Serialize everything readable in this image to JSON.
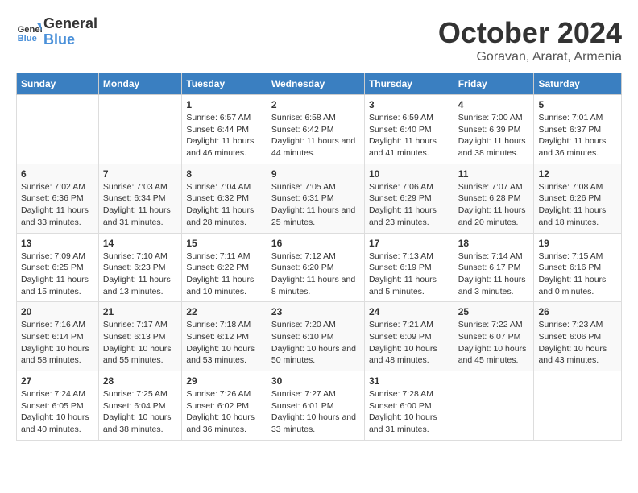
{
  "header": {
    "logo_line1": "General",
    "logo_line2": "Blue",
    "title": "October 2024",
    "subtitle": "Goravan, Ararat, Armenia"
  },
  "columns": [
    "Sunday",
    "Monday",
    "Tuesday",
    "Wednesday",
    "Thursday",
    "Friday",
    "Saturday"
  ],
  "weeks": [
    [
      {
        "day": "",
        "info": ""
      },
      {
        "day": "",
        "info": ""
      },
      {
        "day": "1",
        "info": "Sunrise: 6:57 AM\nSunset: 6:44 PM\nDaylight: 11 hours and 46 minutes."
      },
      {
        "day": "2",
        "info": "Sunrise: 6:58 AM\nSunset: 6:42 PM\nDaylight: 11 hours and 44 minutes."
      },
      {
        "day": "3",
        "info": "Sunrise: 6:59 AM\nSunset: 6:40 PM\nDaylight: 11 hours and 41 minutes."
      },
      {
        "day": "4",
        "info": "Sunrise: 7:00 AM\nSunset: 6:39 PM\nDaylight: 11 hours and 38 minutes."
      },
      {
        "day": "5",
        "info": "Sunrise: 7:01 AM\nSunset: 6:37 PM\nDaylight: 11 hours and 36 minutes."
      }
    ],
    [
      {
        "day": "6",
        "info": "Sunrise: 7:02 AM\nSunset: 6:36 PM\nDaylight: 11 hours and 33 minutes."
      },
      {
        "day": "7",
        "info": "Sunrise: 7:03 AM\nSunset: 6:34 PM\nDaylight: 11 hours and 31 minutes."
      },
      {
        "day": "8",
        "info": "Sunrise: 7:04 AM\nSunset: 6:32 PM\nDaylight: 11 hours and 28 minutes."
      },
      {
        "day": "9",
        "info": "Sunrise: 7:05 AM\nSunset: 6:31 PM\nDaylight: 11 hours and 25 minutes."
      },
      {
        "day": "10",
        "info": "Sunrise: 7:06 AM\nSunset: 6:29 PM\nDaylight: 11 hours and 23 minutes."
      },
      {
        "day": "11",
        "info": "Sunrise: 7:07 AM\nSunset: 6:28 PM\nDaylight: 11 hours and 20 minutes."
      },
      {
        "day": "12",
        "info": "Sunrise: 7:08 AM\nSunset: 6:26 PM\nDaylight: 11 hours and 18 minutes."
      }
    ],
    [
      {
        "day": "13",
        "info": "Sunrise: 7:09 AM\nSunset: 6:25 PM\nDaylight: 11 hours and 15 minutes."
      },
      {
        "day": "14",
        "info": "Sunrise: 7:10 AM\nSunset: 6:23 PM\nDaylight: 11 hours and 13 minutes."
      },
      {
        "day": "15",
        "info": "Sunrise: 7:11 AM\nSunset: 6:22 PM\nDaylight: 11 hours and 10 minutes."
      },
      {
        "day": "16",
        "info": "Sunrise: 7:12 AM\nSunset: 6:20 PM\nDaylight: 11 hours and 8 minutes."
      },
      {
        "day": "17",
        "info": "Sunrise: 7:13 AM\nSunset: 6:19 PM\nDaylight: 11 hours and 5 minutes."
      },
      {
        "day": "18",
        "info": "Sunrise: 7:14 AM\nSunset: 6:17 PM\nDaylight: 11 hours and 3 minutes."
      },
      {
        "day": "19",
        "info": "Sunrise: 7:15 AM\nSunset: 6:16 PM\nDaylight: 11 hours and 0 minutes."
      }
    ],
    [
      {
        "day": "20",
        "info": "Sunrise: 7:16 AM\nSunset: 6:14 PM\nDaylight: 10 hours and 58 minutes."
      },
      {
        "day": "21",
        "info": "Sunrise: 7:17 AM\nSunset: 6:13 PM\nDaylight: 10 hours and 55 minutes."
      },
      {
        "day": "22",
        "info": "Sunrise: 7:18 AM\nSunset: 6:12 PM\nDaylight: 10 hours and 53 minutes."
      },
      {
        "day": "23",
        "info": "Sunrise: 7:20 AM\nSunset: 6:10 PM\nDaylight: 10 hours and 50 minutes."
      },
      {
        "day": "24",
        "info": "Sunrise: 7:21 AM\nSunset: 6:09 PM\nDaylight: 10 hours and 48 minutes."
      },
      {
        "day": "25",
        "info": "Sunrise: 7:22 AM\nSunset: 6:07 PM\nDaylight: 10 hours and 45 minutes."
      },
      {
        "day": "26",
        "info": "Sunrise: 7:23 AM\nSunset: 6:06 PM\nDaylight: 10 hours and 43 minutes."
      }
    ],
    [
      {
        "day": "27",
        "info": "Sunrise: 7:24 AM\nSunset: 6:05 PM\nDaylight: 10 hours and 40 minutes."
      },
      {
        "day": "28",
        "info": "Sunrise: 7:25 AM\nSunset: 6:04 PM\nDaylight: 10 hours and 38 minutes."
      },
      {
        "day": "29",
        "info": "Sunrise: 7:26 AM\nSunset: 6:02 PM\nDaylight: 10 hours and 36 minutes."
      },
      {
        "day": "30",
        "info": "Sunrise: 7:27 AM\nSunset: 6:01 PM\nDaylight: 10 hours and 33 minutes."
      },
      {
        "day": "31",
        "info": "Sunrise: 7:28 AM\nSunset: 6:00 PM\nDaylight: 10 hours and 31 minutes."
      },
      {
        "day": "",
        "info": ""
      },
      {
        "day": "",
        "info": ""
      }
    ]
  ]
}
